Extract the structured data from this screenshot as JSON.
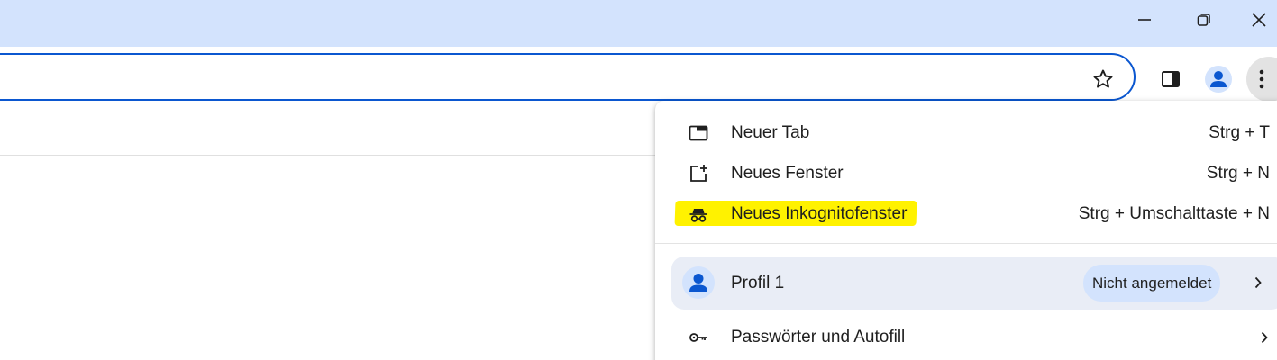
{
  "titlebar": {
    "window_controls": [
      "minimize-icon",
      "restore-icon",
      "close-icon"
    ]
  },
  "toolbar": {
    "icons": [
      "star-icon",
      "side-panel-icon",
      "profile-avatar-icon",
      "more-vert-icon"
    ]
  },
  "menu": {
    "items": [
      {
        "icon": "new-tab-icon",
        "label": "Neuer Tab",
        "shortcut": "Strg + T"
      },
      {
        "icon": "new-window-icon",
        "label": "Neues Fenster",
        "shortcut": "Strg + N"
      },
      {
        "icon": "incognito-icon",
        "label": "Neues Inkognitofenster",
        "shortcut": "Strg + Umschalttaste + N",
        "highlighted": true
      }
    ],
    "profile": {
      "icon": "person-icon",
      "label": "Profil 1",
      "badge": "Nicht angemeldet"
    },
    "passwords": {
      "icon": "key-icon",
      "label": "Passwörter und Autofill"
    }
  },
  "colors": {
    "titlebar_bg": "#d3e3fd",
    "omnibox_border": "#0b57d0",
    "highlight": "#fff200",
    "profile_row_bg": "#e9edf6",
    "badge_bg": "#d3e3fd",
    "avatar_fg": "#0b57d0"
  }
}
